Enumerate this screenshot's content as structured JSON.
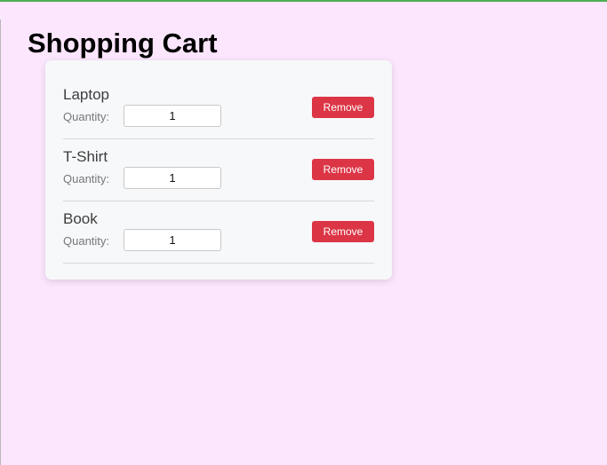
{
  "page": {
    "title": "Shopping Cart"
  },
  "cart": {
    "items": [
      {
        "name": "Laptop",
        "quantity_label": "Quantity:",
        "quantity": "1",
        "remove_label": "Remove"
      },
      {
        "name": "T-Shirt",
        "quantity_label": "Quantity:",
        "quantity": "1",
        "remove_label": "Remove"
      },
      {
        "name": "Book",
        "quantity_label": "Quantity:",
        "quantity": "1",
        "remove_label": "Remove"
      }
    ]
  },
  "colors": {
    "page_background": "#fbe6fd",
    "card_background": "#f7f8fa",
    "remove_button": "#dc3545",
    "top_border": "#4caf50"
  }
}
